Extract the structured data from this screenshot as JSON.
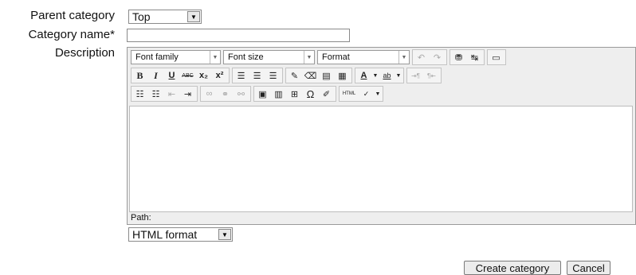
{
  "form": {
    "parent_label": "Parent category",
    "parent_value": "Top",
    "name_label": "Category name*",
    "name_value": "",
    "description_label": "Description"
  },
  "editor": {
    "font_family": "Font family",
    "font_size": "Font size",
    "format": "Format",
    "path_label": "Path:",
    "toolbar_icons": {
      "undo": "undo-icon",
      "redo": "redo-icon",
      "find": "binoculars-icon",
      "replace": "replace-icon",
      "fullscreen": "fullscreen-icon",
      "bold": "B",
      "italic": "I",
      "underline": "U",
      "strike": "ABC",
      "subscript": "x₂",
      "superscript": "x²"
    },
    "html_label": "HTML"
  },
  "format_select": {
    "value": "HTML format"
  },
  "buttons": {
    "create": "Create category",
    "cancel": "Cancel"
  }
}
